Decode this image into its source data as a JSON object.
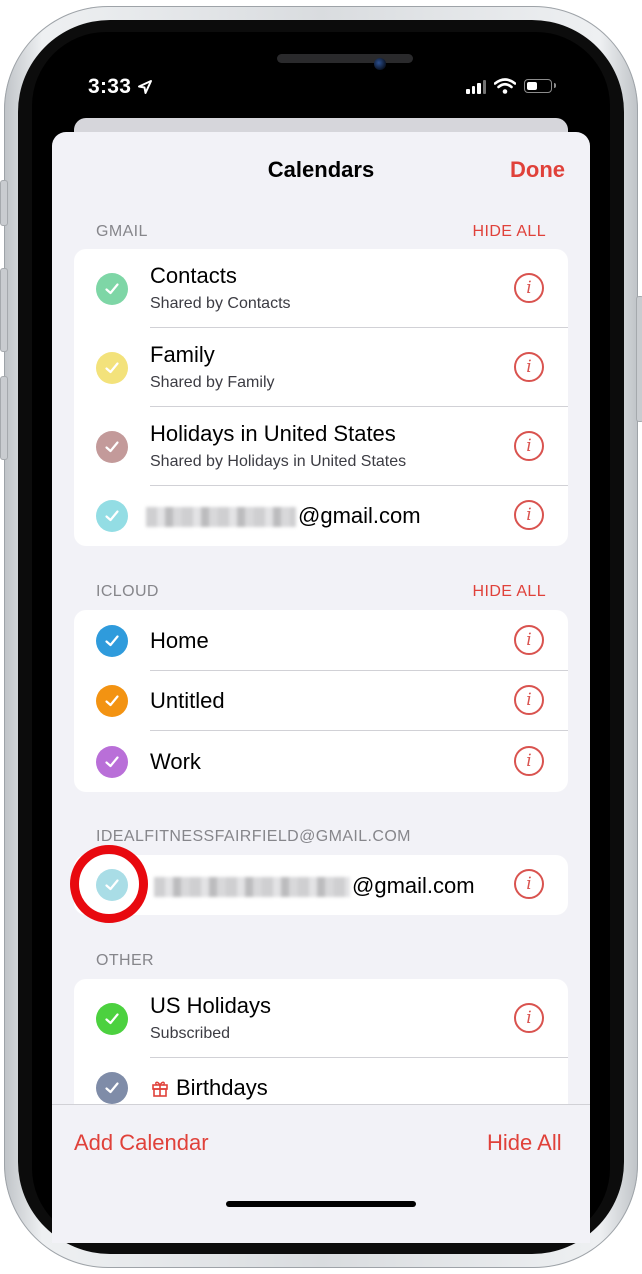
{
  "status_bar": {
    "time": "3:33"
  },
  "nav": {
    "title": "Calendars",
    "done_label": "Done"
  },
  "sections": {
    "gmail": {
      "header": "GMAIL",
      "hide_all": "HIDE ALL",
      "items": [
        {
          "title": "Contacts",
          "subtitle": "Shared by Contacts",
          "color": "#7ed6a6"
        },
        {
          "title": "Family",
          "subtitle": "Shared by Family",
          "color": "#f3e27b"
        },
        {
          "title": "Holidays in United States",
          "subtitle": "Shared by Holidays in United States",
          "color": "#c39a9a"
        },
        {
          "title": "@gmail.com",
          "color": "#93dde4"
        }
      ]
    },
    "icloud": {
      "header": "ICLOUD",
      "hide_all": "HIDE ALL",
      "items": [
        {
          "title": "Home",
          "color": "#2f9bdc"
        },
        {
          "title": "Untitled",
          "color": "#f39312"
        },
        {
          "title": "Work",
          "color": "#b96fd8"
        }
      ]
    },
    "idealfitness": {
      "header": "IDEALFITNESSFAIRFIELD@GMAIL.COM",
      "items": [
        {
          "title": "@gmail.com",
          "color": "#a9dde6"
        }
      ]
    },
    "other": {
      "header": "OTHER",
      "items": [
        {
          "title": "US Holidays",
          "subtitle": "Subscribed",
          "color": "#4cd13f"
        },
        {
          "title": "Birthdays",
          "color": "#7f8ca8"
        }
      ]
    }
  },
  "footer": {
    "add_calendar": "Add Calendar",
    "hide_all": "Hide All"
  },
  "colors": {
    "accent": "#e0413a",
    "annotation_ring": "#e8090f"
  }
}
